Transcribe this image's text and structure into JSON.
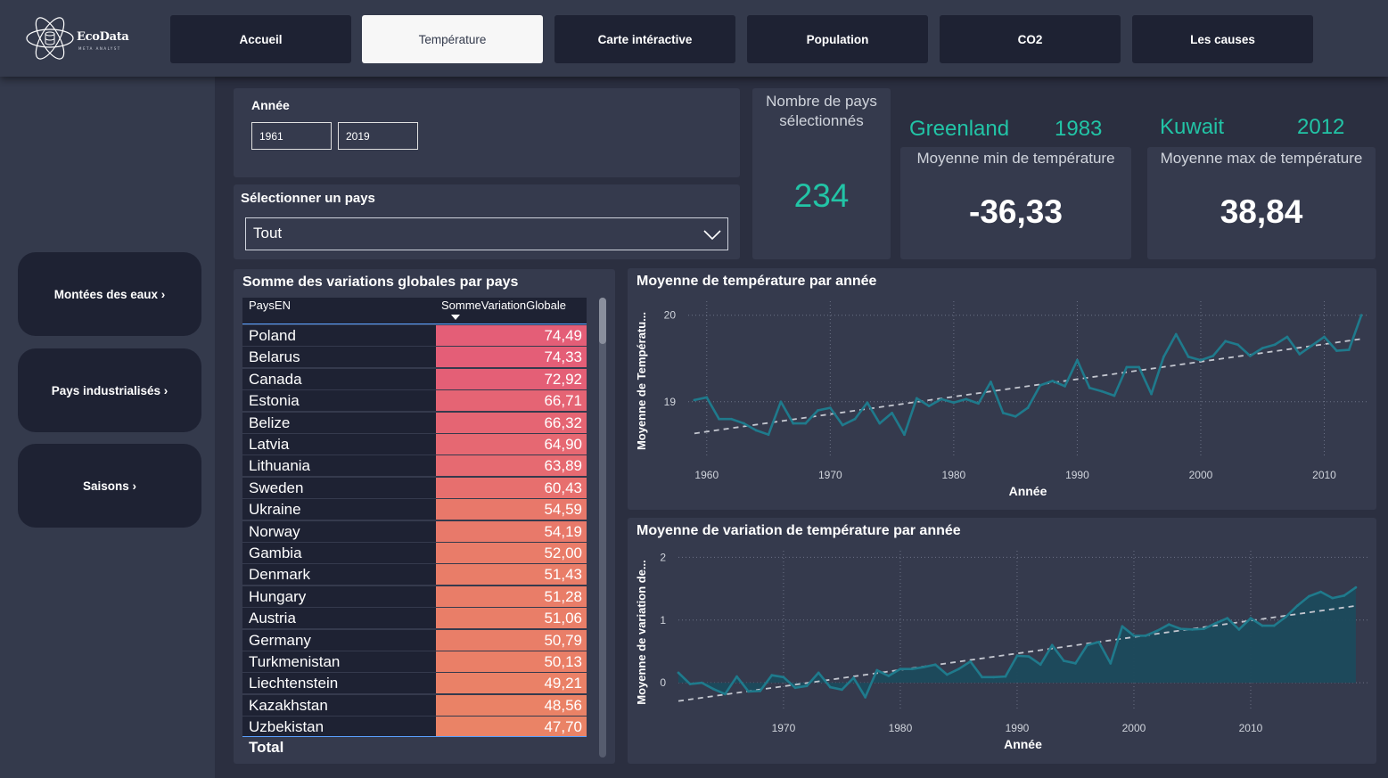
{
  "brand": {
    "name": "EcoData",
    "subtitle": "META ANALYST"
  },
  "tabs": [
    {
      "label": "Accueil"
    },
    {
      "label": "Température",
      "active": true
    },
    {
      "label": "Carte intéractive"
    },
    {
      "label": "Population"
    },
    {
      "label": "CO2"
    },
    {
      "label": "Les causes"
    }
  ],
  "sidebar": {
    "items": [
      {
        "label": "Montées des eaux ›"
      },
      {
        "label": "Pays industrialisés ›"
      },
      {
        "label": "Saisons ›"
      }
    ]
  },
  "filters": {
    "year_label": "Année",
    "year_from": "1961",
    "year_to": "2019",
    "country_label": "Sélectionner un pays",
    "country_value": "Tout"
  },
  "kpis": {
    "count_title": "Nombre de pays sélectionnés",
    "count_value": "234",
    "min_country": "Greenland",
    "min_year": "1983",
    "min_title": "Moyenne min de température",
    "min_value": "-36,33",
    "max_country": "Kuwait",
    "max_year": "2012",
    "max_title": "Moyenne max de température",
    "max_value": "38,84"
  },
  "table": {
    "title": "Somme des variations globales par pays",
    "col1": "PaysEN",
    "col2": "SommeVariationGlobale",
    "sort": "descending",
    "rows": [
      {
        "country": "Poland",
        "value": "74,49",
        "color": "#e45e77"
      },
      {
        "country": "Belarus",
        "value": "74,33",
        "color": "#e45e77"
      },
      {
        "country": "Canada",
        "value": "72,92",
        "color": "#e45f76"
      },
      {
        "country": "Estonia",
        "value": "66,71",
        "color": "#e56474"
      },
      {
        "country": "Belize",
        "value": "66,32",
        "color": "#e56573"
      },
      {
        "country": "Latvia",
        "value": "64,90",
        "color": "#e66872"
      },
      {
        "country": "Lithuania",
        "value": "63,89",
        "color": "#e66a71"
      },
      {
        "country": "Sweden",
        "value": "60,43",
        "color": "#e76f6e"
      },
      {
        "country": "Ukraine",
        "value": "54,59",
        "color": "#e8786a"
      },
      {
        "country": "Norway",
        "value": "54,19",
        "color": "#e8796a"
      },
      {
        "country": "Gambia",
        "value": "52,00",
        "color": "#e97c69"
      },
      {
        "country": "Denmark",
        "value": "51,43",
        "color": "#e97d68"
      },
      {
        "country": "Hungary",
        "value": "51,28",
        "color": "#e97d68"
      },
      {
        "country": "Austria",
        "value": "51,06",
        "color": "#e97e68"
      },
      {
        "country": "Germany",
        "value": "50,79",
        "color": "#e97e68"
      },
      {
        "country": "Turkmenistan",
        "value": "50,13",
        "color": "#ea7f67"
      },
      {
        "country": "Liechtenstein",
        "value": "49,21",
        "color": "#ea8167"
      },
      {
        "country": "Kazakhstan",
        "value": "48,56",
        "color": "#ea8266"
      },
      {
        "country": "Uzbekistan",
        "value": "47,70",
        "color": "#ea8366"
      }
    ],
    "total_label": "Total"
  },
  "chart_data": [
    {
      "type": "line",
      "title": "Moyenne de température par année",
      "xlabel": "Année",
      "ylabel": "Moyenne de Températu...",
      "xlim": [
        1958.5,
        2013.5
      ],
      "ylim": [
        18.38,
        20.1
      ],
      "xticks": [
        1960,
        1970,
        1980,
        1990,
        2000,
        2010
      ],
      "yticks": [
        19,
        20
      ],
      "grid": true,
      "trendline": true,
      "color": "#1f7a8c",
      "x": [
        1959,
        1960,
        1961,
        1962,
        1963,
        1964,
        1965,
        1966,
        1967,
        1968,
        1969,
        1970,
        1971,
        1972,
        1973,
        1974,
        1975,
        1976,
        1977,
        1978,
        1979,
        1980,
        1981,
        1982,
        1983,
        1984,
        1985,
        1986,
        1987,
        1988,
        1989,
        1990,
        1991,
        1992,
        1993,
        1994,
        1995,
        1996,
        1997,
        1998,
        1999,
        2000,
        2001,
        2002,
        2003,
        2004,
        2005,
        2006,
        2007,
        2008,
        2009,
        2010,
        2011,
        2012,
        2013
      ],
      "values": [
        19.02,
        19.05,
        18.8,
        18.8,
        18.75,
        18.67,
        18.62,
        19.0,
        18.75,
        18.75,
        18.9,
        18.93,
        18.73,
        18.8,
        18.99,
        18.75,
        18.87,
        18.62,
        19.04,
        18.95,
        19.03,
        18.99,
        19.03,
        18.98,
        19.23,
        18.87,
        18.83,
        18.93,
        19.19,
        19.24,
        19.18,
        19.48,
        19.16,
        19.12,
        19.07,
        19.4,
        19.4,
        19.09,
        19.52,
        19.78,
        19.52,
        19.48,
        19.53,
        19.7,
        19.66,
        19.53,
        19.62,
        19.66,
        19.75,
        19.55,
        19.65,
        19.75,
        19.59,
        19.6,
        20.0
      ]
    },
    {
      "type": "area",
      "title": "Moyenne de variation de température par année",
      "xlabel": "Année",
      "ylabel": "Moyenne de variation de...",
      "xlim": [
        1961,
        2020
      ],
      "ylim": [
        -0.41,
        2.02
      ],
      "xticks": [
        1970,
        1980,
        1990,
        2000,
        2010
      ],
      "yticks": [
        0,
        1,
        2
      ],
      "grid": true,
      "trendline": true,
      "color": "#1f7a8c",
      "fill": "#1c4a5c",
      "x": [
        1961,
        1962,
        1963,
        1964,
        1965,
        1966,
        1967,
        1968,
        1969,
        1970,
        1971,
        1972,
        1973,
        1974,
        1975,
        1976,
        1977,
        1978,
        1979,
        1980,
        1981,
        1982,
        1983,
        1984,
        1985,
        1986,
        1987,
        1988,
        1989,
        1990,
        1991,
        1992,
        1993,
        1994,
        1995,
        1996,
        1997,
        1998,
        1999,
        2000,
        2001,
        2002,
        2003,
        2004,
        2005,
        2006,
        2007,
        2008,
        2009,
        2010,
        2011,
        2012,
        2013,
        2014,
        2015,
        2016,
        2017,
        2018,
        2019
      ],
      "values": [
        0.16,
        -0.02,
        0.0,
        -0.1,
        -0.18,
        0.1,
        -0.14,
        -0.13,
        0.12,
        0.09,
        -0.08,
        -0.05,
        0.16,
        -0.07,
        -0.11,
        0.08,
        -0.23,
        0.2,
        0.11,
        0.22,
        0.22,
        0.25,
        0.29,
        0.13,
        0.22,
        0.34,
        0.09,
        0.09,
        0.1,
        0.43,
        0.42,
        0.29,
        0.6,
        0.35,
        0.31,
        0.6,
        0.65,
        0.31,
        0.9,
        0.75,
        0.75,
        0.83,
        0.93,
        0.86,
        0.85,
        0.86,
        0.95,
        1.03,
        0.85,
        1.03,
        0.91,
        0.91,
        1.05,
        1.23,
        1.38,
        1.45,
        1.35,
        1.39,
        1.52
      ]
    }
  ]
}
